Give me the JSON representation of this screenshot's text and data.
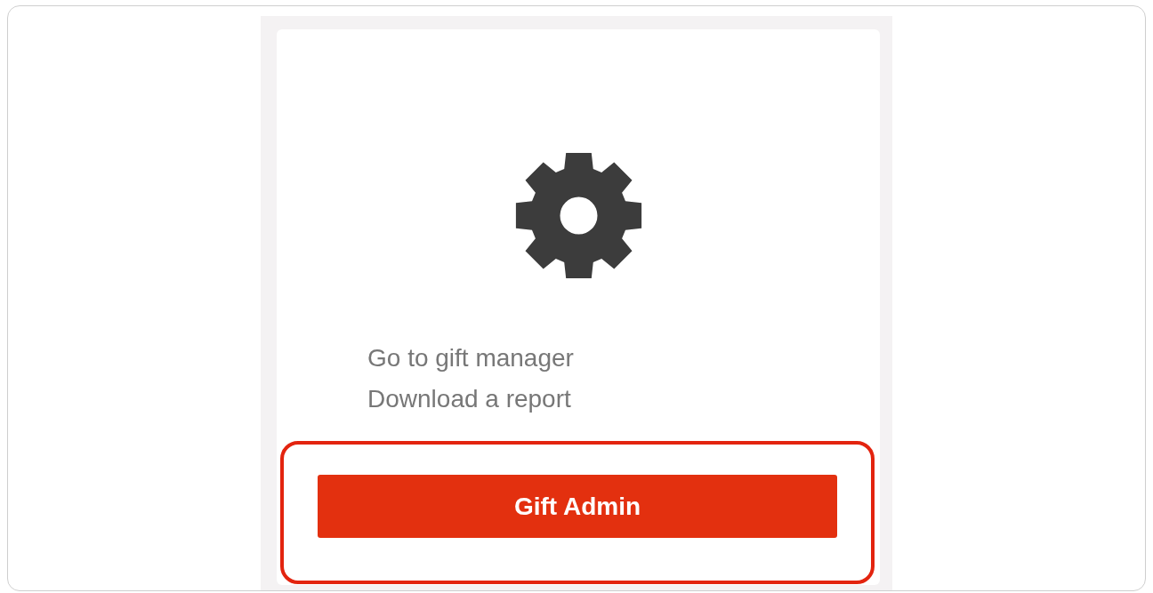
{
  "card": {
    "lines": [
      "Go to gift manager",
      "Download a report"
    ],
    "button": "Gift Admin"
  },
  "highlight": {
    "on": true
  }
}
